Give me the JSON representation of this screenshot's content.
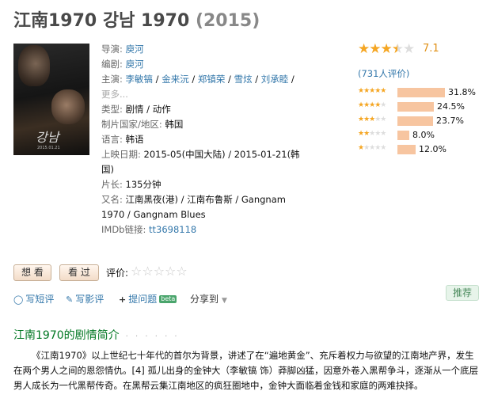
{
  "title": {
    "main": "江南1970 강남 1970",
    "year": "(2015)"
  },
  "info": {
    "director_label": "导演: ",
    "director": "庾河",
    "writer_label": "编剧: ",
    "writer": "庾河",
    "cast_label": "主演: ",
    "cast": [
      "李敏镐",
      "金来沅",
      "郑镇荣",
      "雪炫",
      "刘承睦"
    ],
    "cast_sep": " / ",
    "cast_more": "更多...",
    "genre_label": "类型: ",
    "genre": [
      "剧情",
      "动作"
    ],
    "country_label": "制片国家/地区: ",
    "country": "韩国",
    "language_label": "语言: ",
    "language": "韩语",
    "release_label": "上映日期: ",
    "release": "2015-05(中国大陆) / 2015-01-21(韩国)",
    "runtime_label": "片长: ",
    "runtime": "135分钟",
    "aka_label": "又名: ",
    "aka": "江南黑夜(港) / 江南布鲁斯 / Gangnam 1970 / Gangnam Blues",
    "imdb_label": "IMDb链接: ",
    "imdb": "tt3698118"
  },
  "rating": {
    "score": "7.1",
    "stars_value": 3.5,
    "votes_text": "(731人评价)",
    "distribution": [
      {
        "stars": 5,
        "pct": "31.8%",
        "value": 31.8
      },
      {
        "stars": 4,
        "pct": "24.5%",
        "value": 24.5
      },
      {
        "stars": 3,
        "pct": "23.7%",
        "value": 23.7
      },
      {
        "stars": 2,
        "pct": "8.0%",
        "value": 8.0
      },
      {
        "stars": 1,
        "pct": "12.0%",
        "value": 12.0
      }
    ]
  },
  "buttons": {
    "want": "想 看",
    "seen": "看 过",
    "rate_label": "评价:"
  },
  "actions": {
    "comment": "写短评",
    "review": "写影评",
    "question": "提问题",
    "beta": "beta",
    "share": "分享到",
    "recommend": "推荐"
  },
  "poster": {
    "logo": "강남",
    "date": "2015.01.21"
  },
  "summary": {
    "title": "江南1970的剧情简介",
    "dots": "· · · · · ·",
    "text": "《江南1970》以上世纪七十年代的首尔为背景，讲述了在“遍地黄金”、充斥着权力与欲望的江南地产界，发生在两个男人之间的恩怨情仇。[4] 孤儿出身的金钟大（李敏镐 饰）莽脚凶猛，因意外卷入黑帮争斗，逐渐从一个底层男人成长为一代黑帮传奇。在黑帮云集江南地区的疯狂圈地中，金钟大面临着金钱和家庭的两难抉择。"
  },
  "colors": {
    "accent": "#3377aa",
    "star": "#f5a623",
    "bar": "#f7c5a0",
    "section": "#007722"
  }
}
